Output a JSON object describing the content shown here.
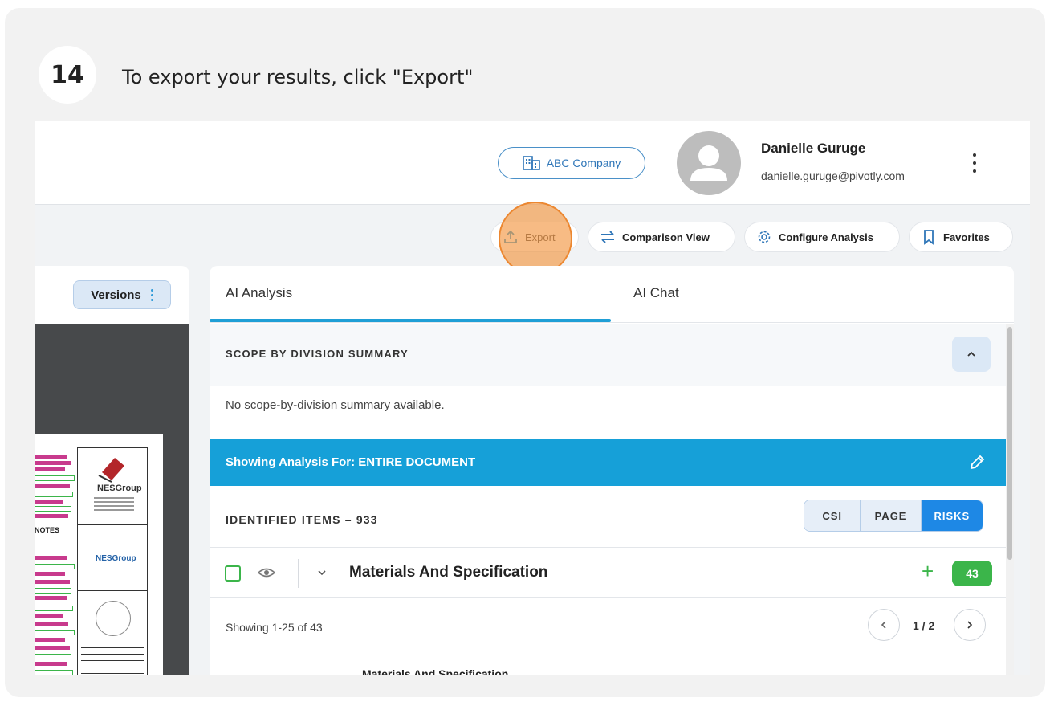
{
  "step": {
    "number": "14",
    "instruction": "To export your results, click \"Export\""
  },
  "header": {
    "company_label": "ABC Company",
    "user_name": "Danielle Guruge",
    "user_email": "danielle.guruge@pivotly.com"
  },
  "toolbar": {
    "export_label": "Export",
    "comparison_label": "Comparison View",
    "configure_label": "Configure Analysis",
    "favorites_label": "Favorites"
  },
  "left_panel": {
    "versions_label": "Versions",
    "doc_logo_text": "NESGroup",
    "doc_logo_sub": "NESGroup",
    "doc_notes_label": "NOTES"
  },
  "tabs": [
    {
      "label": "AI Analysis",
      "active": true
    },
    {
      "label": "AI Chat",
      "active": false
    }
  ],
  "scope": {
    "title": "SCOPE BY DIVISION SUMMARY",
    "empty_message": "No scope-by-division summary available."
  },
  "banner": {
    "text": "Showing Analysis For: ENTIRE DOCUMENT"
  },
  "identified": {
    "label": "IDENTIFIED ITEMS – 933",
    "segments": [
      "CSI",
      "PAGE",
      "RISKS"
    ],
    "active_segment": "RISKS"
  },
  "group": {
    "title": "Materials And Specification",
    "count": "43",
    "showing": "Showing 1-25 of 43",
    "page_indicator": "1 / 2",
    "peek_text": "Materials And Specification"
  },
  "colors": {
    "accent": "#16a0d8",
    "active_segment": "#1e88e5",
    "success": "#3bb54a",
    "highlight": "#f29238"
  }
}
